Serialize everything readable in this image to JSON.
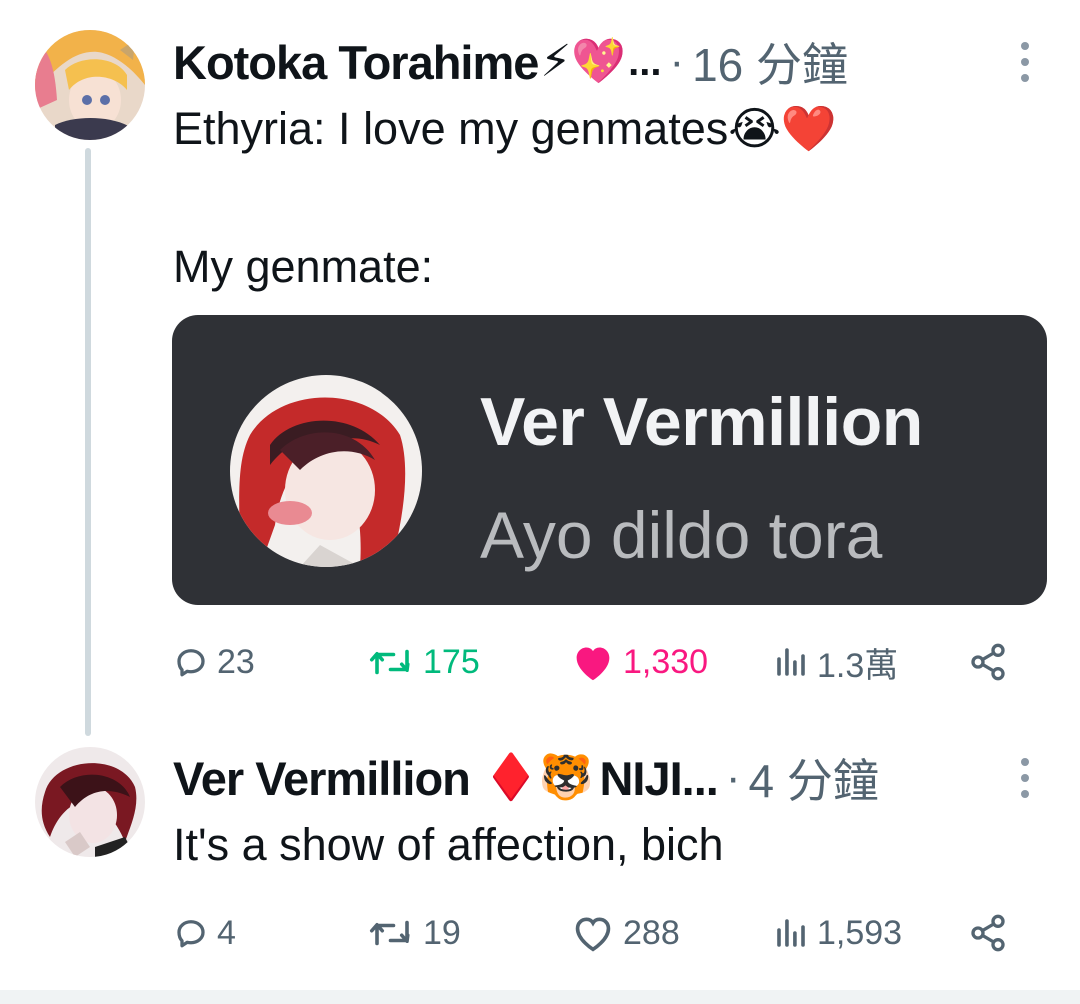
{
  "tweets": [
    {
      "author_name": "Kotoka Torahime",
      "author_emojis": "⚡💖",
      "truncated": "...",
      "separator": "·",
      "time": "16 分鐘",
      "text_line1": "Ethyria: I love my genmates😭❤️",
      "text_line2": "My genmate:",
      "media": {
        "name": "Ver Vermillion",
        "message": "Ayo dildo tora"
      },
      "actions": {
        "replies": "23",
        "retweets": "175",
        "likes": "1,330",
        "views": "1.3萬"
      },
      "liked": true
    },
    {
      "author_name": "Ver Vermillion",
      "author_emojis": "♦️🐯",
      "author_extra": "NIJI...",
      "separator": "·",
      "time": "4 分鐘",
      "text_line1": "It's a show of affection, bich",
      "actions": {
        "replies": "4",
        "retweets": "19",
        "likes": "288",
        "views": "1,593"
      },
      "liked": false
    }
  ],
  "icons": {
    "reply": "reply-icon",
    "retweet": "retweet-icon",
    "like": "heart-icon",
    "views": "views-icon",
    "share": "share-icon",
    "more": "more-icon"
  },
  "colors": {
    "text": "#0f1419",
    "muted": "#536471",
    "retweet_green": "#00ba7c",
    "like_pink": "#f91880",
    "media_bg": "#2f3136"
  }
}
